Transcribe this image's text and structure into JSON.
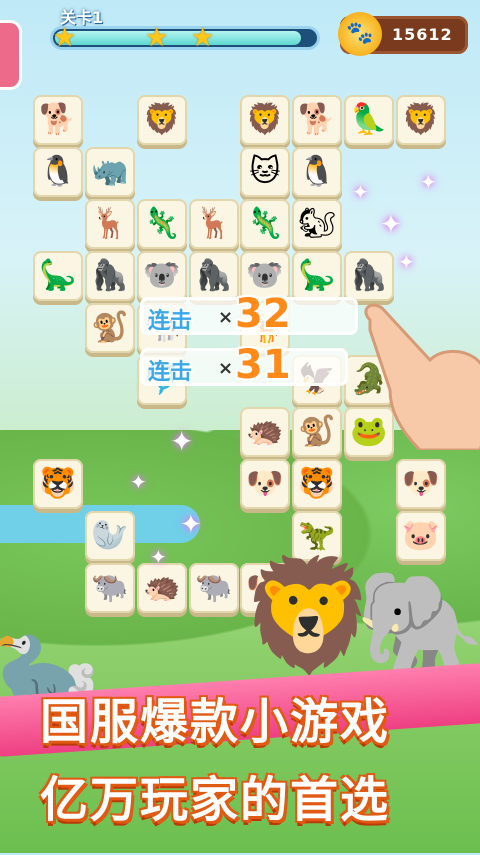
{
  "header": {
    "level_label": "关卡1",
    "coin_value": "15612",
    "coin_icon": "paw-coin-icon",
    "stars_earned": 3,
    "progress_fraction": 0.95
  },
  "board": {
    "tiles": [
      {
        "animal": "dog",
        "glyph": "🐕"
      },
      {
        "animal": "lion",
        "glyph": "🦁"
      },
      {
        "animal": "lion",
        "glyph": "🦁"
      },
      {
        "animal": "dog",
        "glyph": "🐕"
      },
      {
        "animal": "parrot",
        "glyph": "🦜"
      },
      {
        "animal": "lion",
        "glyph": "🦁"
      },
      {
        "animal": "penguin",
        "glyph": "🐧"
      },
      {
        "animal": "rhino",
        "glyph": "🦏"
      },
      {
        "animal": "cat",
        "glyph": "🐱"
      },
      {
        "animal": "penguin",
        "glyph": "🐧"
      },
      {
        "animal": "reindeer",
        "glyph": "🦌"
      },
      {
        "animal": "chameleon",
        "glyph": "🦎"
      },
      {
        "animal": "reindeer",
        "glyph": "🦌"
      },
      {
        "animal": "chameleon",
        "glyph": "🦎"
      },
      {
        "animal": "squirrel",
        "glyph": "🐿"
      },
      {
        "animal": "stegosaurus",
        "glyph": "🦕"
      },
      {
        "animal": "gorilla",
        "glyph": "🦍"
      },
      {
        "animal": "koala",
        "glyph": "🐨"
      },
      {
        "animal": "gorilla",
        "glyph": "🦍"
      },
      {
        "animal": "koala",
        "glyph": "🐨"
      },
      {
        "animal": "stegosaurus",
        "glyph": "🦕"
      },
      {
        "animal": "gorilla",
        "glyph": "🦍"
      },
      {
        "animal": "monkey",
        "glyph": "🐒"
      },
      {
        "animal": "cow",
        "glyph": "🐄"
      },
      {
        "animal": "giraffe",
        "glyph": "🦒"
      },
      {
        "animal": "dolphin",
        "glyph": "🐬"
      },
      {
        "animal": "eagle",
        "glyph": "🦅"
      },
      {
        "animal": "crocodile",
        "glyph": "🐊"
      },
      {
        "animal": "monkey",
        "glyph": "🐒"
      },
      {
        "animal": "hedgehog",
        "glyph": "🦔"
      },
      {
        "animal": "monkey",
        "glyph": "🐒"
      },
      {
        "animal": "frog",
        "glyph": "🐸"
      },
      {
        "animal": "tiger",
        "glyph": "🐯"
      },
      {
        "animal": "dog",
        "glyph": "🐶"
      },
      {
        "animal": "tiger",
        "glyph": "🐯"
      },
      {
        "animal": "dog",
        "glyph": "🐶"
      },
      {
        "animal": "seal",
        "glyph": "🦭"
      },
      {
        "animal": "triceratops",
        "glyph": "🦖"
      },
      {
        "animal": "pig",
        "glyph": "🐷"
      },
      {
        "animal": "yak",
        "glyph": "🐃"
      },
      {
        "animal": "hedgehog",
        "glyph": "🦔"
      },
      {
        "animal": "yak",
        "glyph": "🐃"
      },
      {
        "animal": "dog",
        "glyph": "🐶"
      }
    ]
  },
  "combos": [
    {
      "label": "连击",
      "x": "×",
      "count": "32"
    },
    {
      "label": "连击",
      "x": "×",
      "count": "31"
    }
  ],
  "promo": {
    "line1": "国服爆款小游戏",
    "line2": "亿万玩家的首选"
  },
  "colors": {
    "accent_pink": "#ee3f82",
    "combo_blue": "#3aa7e8",
    "combo_orange": "#ff8a1a",
    "coin_box": "#7a3a1d"
  }
}
